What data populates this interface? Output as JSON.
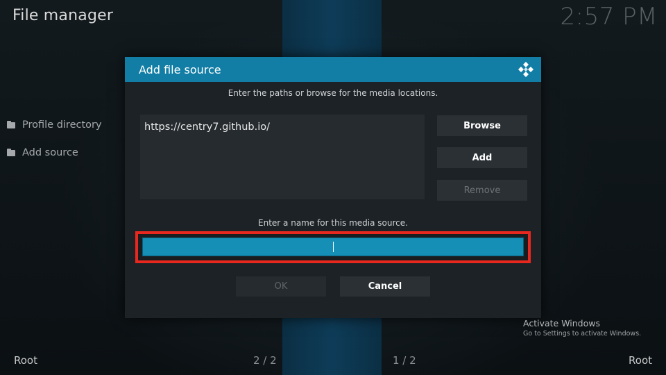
{
  "app": {
    "title": "File manager",
    "clock": "2:57 PM"
  },
  "sidebar": {
    "items": [
      {
        "label": "Profile directory",
        "icon": "folder-icon"
      },
      {
        "label": "Add source",
        "icon": "folder-icon"
      }
    ]
  },
  "footer": {
    "left_label": "Root",
    "left_page": "2 / 2",
    "right_page": "1 / 2",
    "right_label": "Root"
  },
  "watermark": {
    "title": "Activate Windows",
    "subtitle": "Go to Settings to activate Windows."
  },
  "dialog": {
    "title": "Add file source",
    "logo_icon": "kodi-logo-icon",
    "paths_instruction": "Enter the paths or browse for the media locations.",
    "paths": [
      "https://centry7.github.io/"
    ],
    "buttons": {
      "browse": "Browse",
      "add": "Add",
      "remove": "Remove"
    },
    "name_instruction": "Enter a name for this media source.",
    "name_value": "",
    "ok": "OK",
    "cancel": "Cancel"
  },
  "colors": {
    "accent": "#127ea6",
    "input_fill": "#158fb6",
    "highlight_border": "#e8281f",
    "background": "#0d1215"
  }
}
